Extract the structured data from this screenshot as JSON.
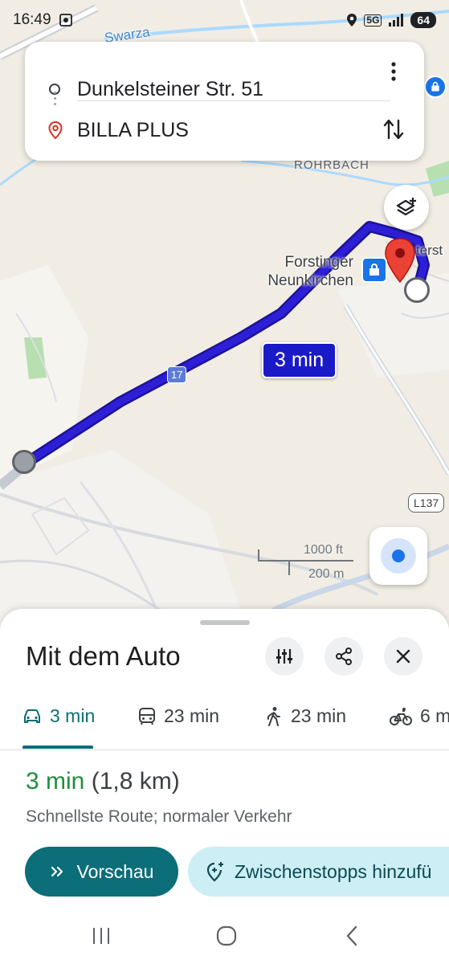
{
  "status_bar": {
    "time": "16:49",
    "network": "5G",
    "battery": "64",
    "icons": [
      "screenshot-icon",
      "location-icon",
      "signal-icon",
      "battery-icon"
    ]
  },
  "directions": {
    "origin": "Dunkelsteiner Str. 51",
    "destination": "BILLA PLUS",
    "icons": [
      "origin-circle-icon",
      "destination-pin-icon",
      "more-vert-icon",
      "swap-icon"
    ]
  },
  "map": {
    "labels": {
      "river": "Swarza",
      "district": "ROHRBACH",
      "poi_name": "Forstinger Neunkirchen",
      "street_partial": "terst"
    },
    "route_time": "3 min",
    "road_17": "17",
    "road_l137": "L137",
    "scale_ft": "1000 ft",
    "scale_m": "200 m",
    "colors": {
      "route": "#2e1fd6",
      "route_outline": "#1a1399",
      "pin": "#ea4335",
      "water": "#aadaff"
    }
  },
  "sheet": {
    "title": "Mit dem Auto",
    "modes": [
      {
        "icon": "car-icon",
        "label": "3 min",
        "active": true
      },
      {
        "icon": "transit-icon",
        "label": "23 min",
        "active": false
      },
      {
        "icon": "walk-icon",
        "label": "23 min",
        "active": false
      },
      {
        "icon": "bike-icon",
        "label": "6 m",
        "active": false
      }
    ],
    "duration": "3 min",
    "distance": "(1,8 km)",
    "description": "Schnellste Route; normaler Verkehr",
    "preview_label": "Vorschau",
    "add_stops_label": "Zwischenstopps hinzufü",
    "accent_color": "#0b6e79"
  }
}
